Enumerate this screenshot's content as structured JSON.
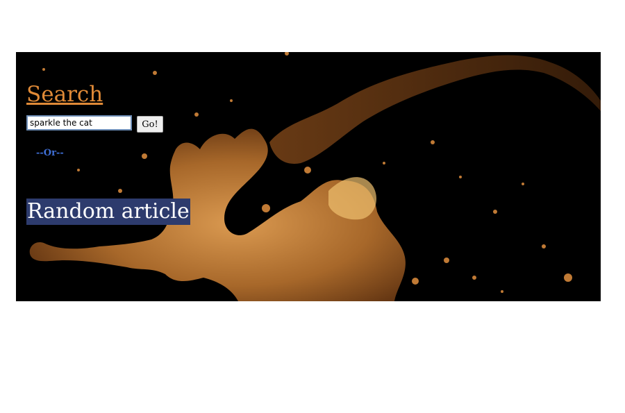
{
  "search": {
    "heading": "Search",
    "input_value": "sparkle the cat",
    "go_label": "Go!"
  },
  "divider_text": "--Or--",
  "random_article_label": "Random article",
  "colors": {
    "background": "#000000",
    "splash": "#c98a3f",
    "search_link": "#e08a37",
    "or_text": "#3f6fd6",
    "random_highlight": "#2d3b6d"
  }
}
